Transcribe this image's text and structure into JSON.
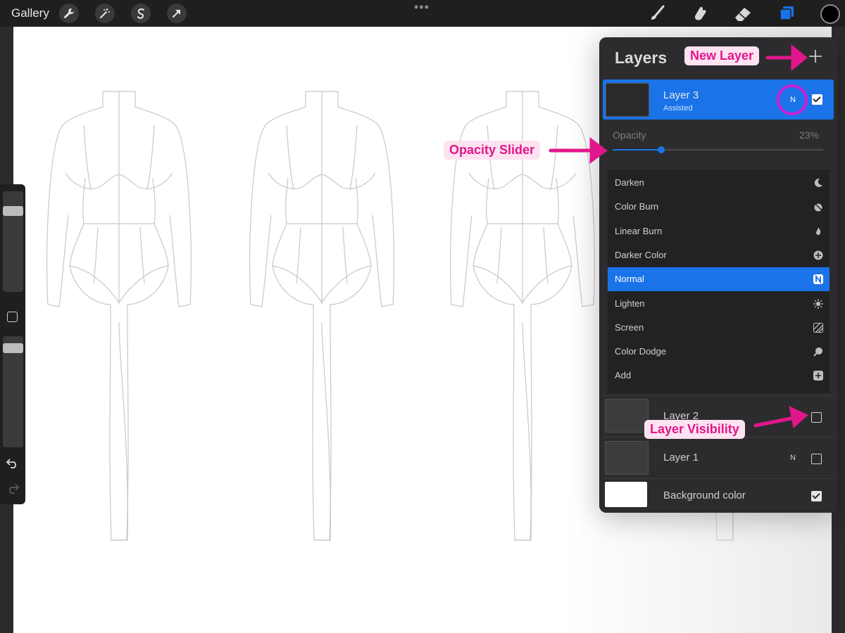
{
  "topbar": {
    "gallery_label": "Gallery",
    "left_tools": [
      "wrench-icon",
      "magic-wand-icon",
      "selection-icon",
      "transform-arrow-icon"
    ],
    "right_tools": [
      "brush-icon",
      "smudge-icon",
      "eraser-icon",
      "layers-icon"
    ],
    "more_indicator": "•••",
    "active_color": "#000000"
  },
  "layers_panel": {
    "title": "Layers",
    "selected_layer": {
      "name": "Layer 3",
      "subtitle": "Assisted",
      "blend_mode_letter": "N",
      "visible": true
    },
    "opacity": {
      "label": "Opacity",
      "value_text": "23%",
      "value": 0.23
    },
    "blend_modes": [
      {
        "label": "Darken",
        "icon": "moon-icon"
      },
      {
        "label": "Color Burn",
        "icon": "burn-icon"
      },
      {
        "label": "Linear Burn",
        "icon": "flame-icon"
      },
      {
        "label": "Darker Color",
        "icon": "plus-circle-icon"
      },
      {
        "label": "Normal",
        "icon": "n-badge-icon"
      },
      {
        "label": "Lighten",
        "icon": "sun-icon"
      },
      {
        "label": "Screen",
        "icon": "hatch-icon"
      },
      {
        "label": "Color Dodge",
        "icon": "dodge-icon"
      },
      {
        "label": "Add",
        "icon": "plus-square-icon"
      }
    ],
    "selected_blend_mode": "Normal",
    "normal_badge": "N",
    "other_layers": [
      {
        "name": "Layer 2",
        "visible": false
      },
      {
        "name": "Layer 1",
        "blend_mode_letter": "N",
        "visible": false
      }
    ],
    "background_layer": {
      "name": "Background color",
      "visible": true
    }
  },
  "annotations": {
    "new_layer": "New Layer",
    "opacity_slider": "Opacity Slider",
    "layer_visibility": "Layer Visibility",
    "color": "#e2168c"
  },
  "colors": {
    "accent": "#1a73e8",
    "panel_bg": "#2c2c2e",
    "toolbar_bg": "#1f1f1f"
  }
}
